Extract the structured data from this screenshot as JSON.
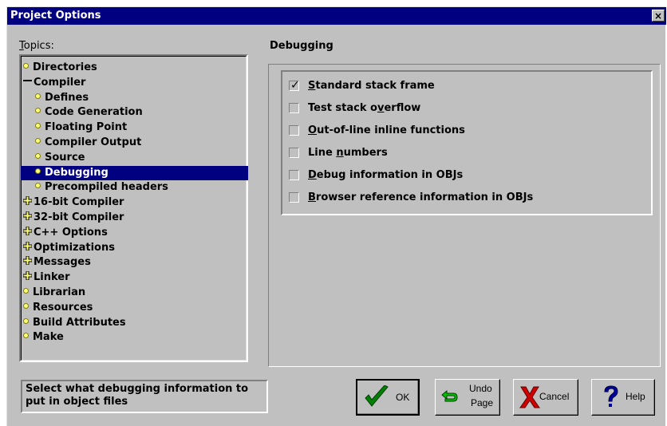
{
  "window": {
    "title": "Project Options",
    "close_glyph": "×"
  },
  "topics_label": "Topics:",
  "topics_label_underline": "T",
  "topics_label_rest": "opics:",
  "tree": [
    {
      "label": "Directories",
      "icon": "bullet-icon",
      "indent": 0,
      "selected": false
    },
    {
      "label": "Compiler",
      "icon": "collapse-minus-icon",
      "indent": 0,
      "selected": false
    },
    {
      "label": "Defines",
      "icon": "bullet-icon",
      "indent": 1,
      "selected": false
    },
    {
      "label": "Code Generation",
      "icon": "bullet-icon",
      "indent": 1,
      "selected": false
    },
    {
      "label": "Floating Point",
      "icon": "bullet-icon",
      "indent": 1,
      "selected": false
    },
    {
      "label": "Compiler Output",
      "icon": "bullet-icon",
      "indent": 1,
      "selected": false
    },
    {
      "label": "Source",
      "icon": "bullet-icon",
      "indent": 1,
      "selected": false
    },
    {
      "label": "Debugging",
      "icon": "bullet-icon",
      "indent": 1,
      "selected": true
    },
    {
      "label": "Precompiled headers",
      "icon": "bullet-icon",
      "indent": 1,
      "selected": false
    },
    {
      "label": "16-bit Compiler",
      "icon": "expand-plus-icon",
      "indent": 0,
      "selected": false
    },
    {
      "label": "32-bit Compiler",
      "icon": "expand-plus-icon",
      "indent": 0,
      "selected": false
    },
    {
      "label": "C++ Options",
      "icon": "expand-plus-icon",
      "indent": 0,
      "selected": false
    },
    {
      "label": "Optimizations",
      "icon": "expand-plus-icon",
      "indent": 0,
      "selected": false
    },
    {
      "label": "Messages",
      "icon": "expand-plus-icon",
      "indent": 0,
      "selected": false
    },
    {
      "label": "Linker",
      "icon": "expand-plus-icon",
      "indent": 0,
      "selected": false
    },
    {
      "label": "Librarian",
      "icon": "bullet-icon",
      "indent": 0,
      "selected": false
    },
    {
      "label": "Resources",
      "icon": "bullet-icon",
      "indent": 0,
      "selected": false
    },
    {
      "label": "Build Attributes",
      "icon": "bullet-icon",
      "indent": 0,
      "selected": false
    },
    {
      "label": "Make",
      "icon": "bullet-icon",
      "indent": 0,
      "selected": false
    }
  ],
  "panel_title": "Debugging",
  "options": [
    {
      "underline": "S",
      "rest": "tandard stack frame",
      "pre": "",
      "checked": true
    },
    {
      "pre": "Test stack o",
      "underline": "v",
      "rest": "erflow",
      "checked": false
    },
    {
      "pre": "",
      "underline": "O",
      "rest": "ut-of-line inline functions",
      "checked": false
    },
    {
      "pre": "Line ",
      "underline": "n",
      "rest": "umbers",
      "checked": false
    },
    {
      "pre": "",
      "underline": "D",
      "rest": "ebug information in OBJs",
      "checked": false
    },
    {
      "pre": "",
      "underline": "B",
      "rest": "rowser reference information in OBJs",
      "checked": false
    }
  ],
  "status_text": "Select what debugging information to put in object files",
  "buttons": {
    "ok": "OK",
    "undo_line1": "Undo",
    "undo_line2": "Page",
    "cancel": "Cancel",
    "help": "Help"
  },
  "colors": {
    "titlebar": "#000080",
    "face": "#c0c0c0",
    "selection": "#000080",
    "ok_check": "#008000",
    "cancel_x": "#c00000",
    "help_q": "#000080",
    "undo_arrow": "#008000"
  }
}
